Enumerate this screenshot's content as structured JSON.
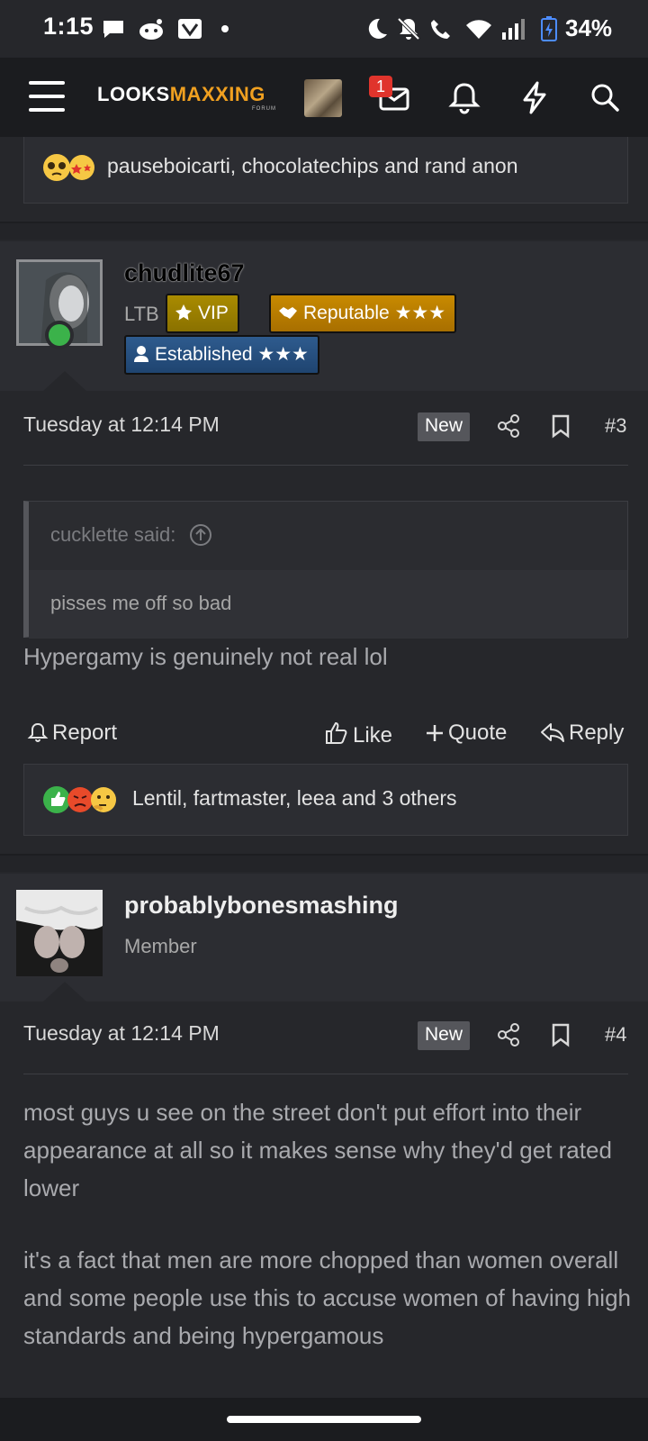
{
  "status_bar": {
    "time": "1:15",
    "battery": "34%",
    "icons": [
      "chat-bubble-icon",
      "reddit-icon",
      "vpn-icon",
      "dot-icon",
      "moon-icon",
      "bell-off-icon",
      "wifi-call-icon",
      "wifi-icon",
      "signal-icon",
      "battery-charging-icon"
    ]
  },
  "header": {
    "logo_main": "LOOKS",
    "logo_accent": "MAXXING",
    "logo_sub": "FORUM",
    "message_count": "1",
    "icons": [
      "menu-icon",
      "avatar",
      "inbox-icon",
      "bell-icon",
      "bolt-icon",
      "search-icon"
    ]
  },
  "prev_reactions": {
    "text": "pauseboicarti, chocolatechips and rand anon",
    "emojis": [
      "pleading-face",
      "star-struck"
    ]
  },
  "posts": [
    {
      "username": "chudlite67",
      "title": "LTB",
      "badges": [
        "VIP",
        "Reputable ★★★",
        "Established ★★★"
      ],
      "date": "Tuesday at 12:14 PM",
      "new_label": "New",
      "post_number": "#3",
      "quote_author": "cucklette said:",
      "quote_text": "pisses me off so bad",
      "body": "Hypergamy is genuinely not real lol",
      "actions": {
        "report": "Report",
        "like": "Like",
        "quote": "Quote",
        "reply": "Reply"
      },
      "reactions_text": "Lentil, fartmaster, leea and 3 others"
    },
    {
      "username": "probablybonesmashing",
      "title": "Member",
      "date": "Tuesday at 12:14 PM",
      "new_label": "New",
      "post_number": "#4",
      "body_p1": "most guys u see on the street don't put effort into their appearance at all so it makes sense why they'd get rated lower",
      "body_p2": "it's a fact that men are more chopped than women overall and some people use this to accuse women of having high standards and being hypergamous"
    }
  ],
  "colors": {
    "background": "#26272b",
    "header": "#1b1c1f",
    "accent": "#f0a020",
    "online": "#3bb24a",
    "badge_red": "#e0342c"
  }
}
